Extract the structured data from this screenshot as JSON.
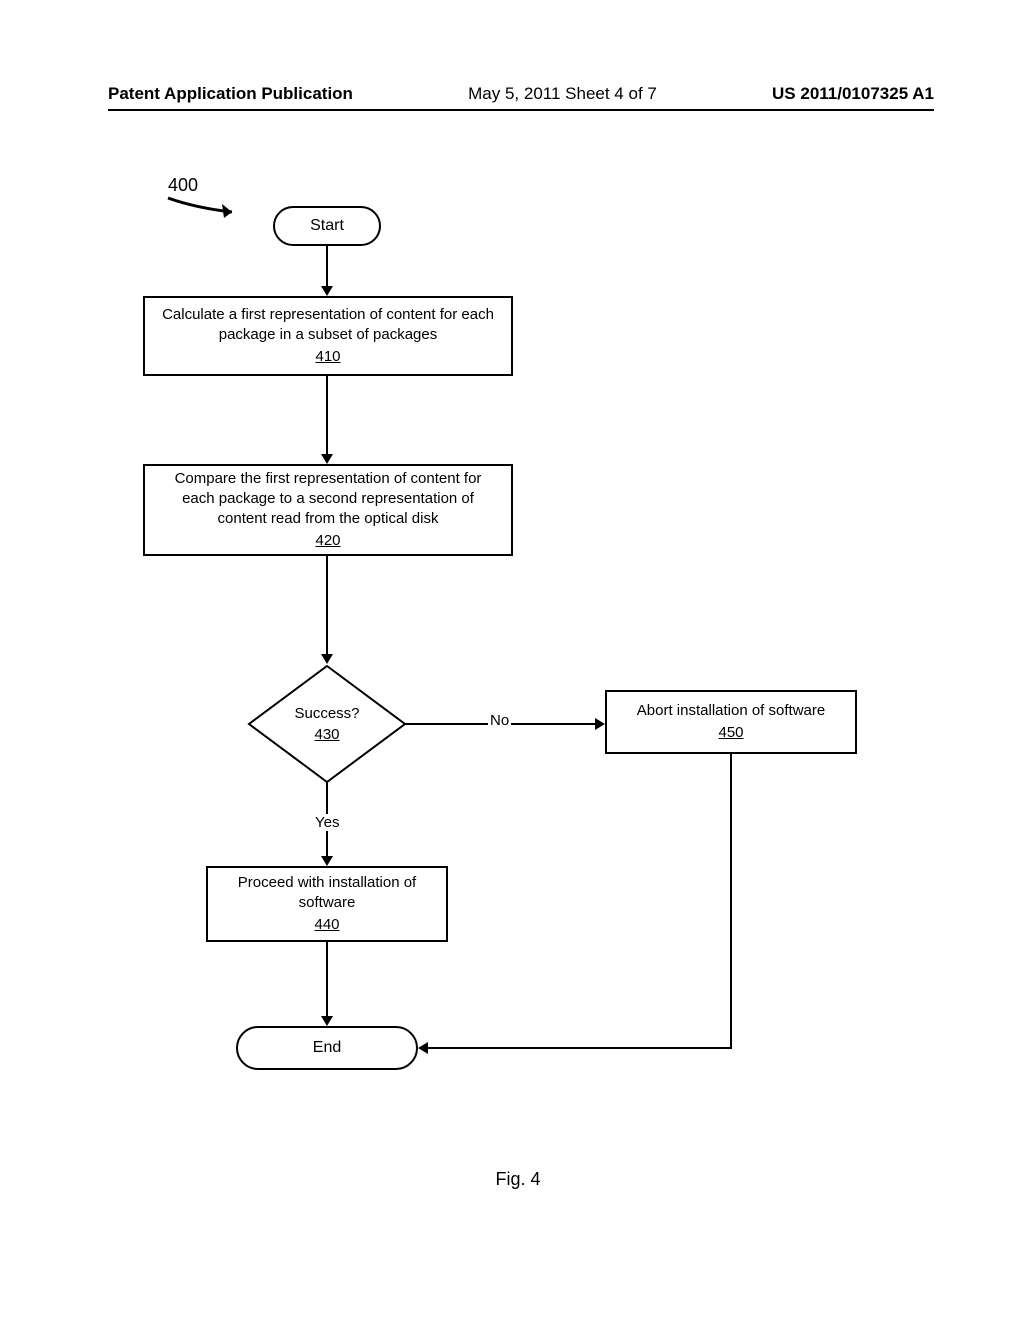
{
  "header": {
    "left": "Patent Application Publication",
    "mid": "May 5, 2011  Sheet 4 of 7",
    "right": "US 2011/0107325 A1"
  },
  "diagram_number": "400",
  "nodes": {
    "start": {
      "label": "Start"
    },
    "n410": {
      "text": "Calculate a first representation of content for each package in a subset of packages",
      "ref": "410"
    },
    "n420": {
      "text": "Compare the first representation of content for each package to a second representation of content read from the optical disk",
      "ref": "420"
    },
    "n430": {
      "text": "Success?",
      "ref": "430"
    },
    "n440": {
      "text": "Proceed with installation of software",
      "ref": "440"
    },
    "n450": {
      "text": "Abort installation of software",
      "ref": "450"
    },
    "end": {
      "label": "End"
    }
  },
  "edges": {
    "yes": "Yes",
    "no": "No"
  },
  "caption": "Fig. 4"
}
